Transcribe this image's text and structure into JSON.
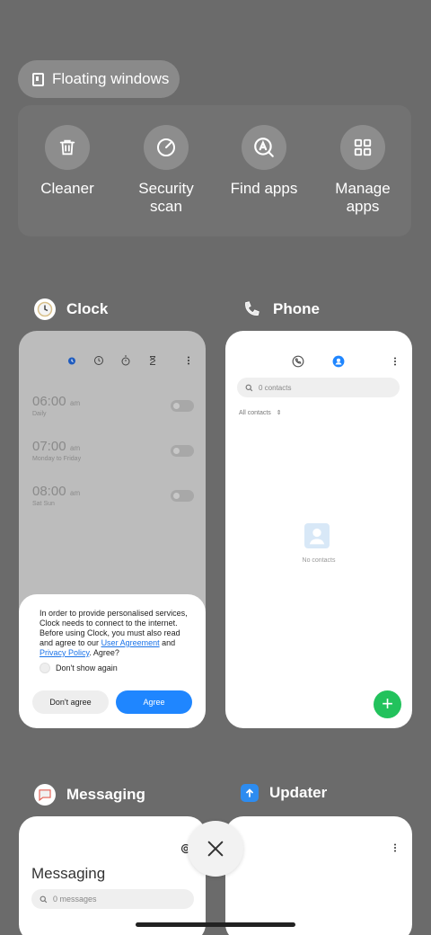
{
  "floating_windows": {
    "label": "Floating windows"
  },
  "tools": [
    {
      "label": "Cleaner",
      "icon": "trash-icon"
    },
    {
      "label": "Security\nscan",
      "icon": "security-scan-icon"
    },
    {
      "label": "Find apps",
      "icon": "find-apps-icon"
    },
    {
      "label": "Manage\napps",
      "icon": "manage-apps-icon"
    }
  ],
  "clock": {
    "title": "Clock",
    "alarms": [
      {
        "time": "06:00",
        "ampm": "am",
        "repeat": "Daily"
      },
      {
        "time": "07:00",
        "ampm": "am",
        "repeat": "Monday to Friday"
      },
      {
        "time": "08:00",
        "ampm": "am",
        "repeat": "Sat Sun"
      }
    ],
    "consent": {
      "text_before": "In order to provide personalised services, Clock needs to connect to the internet. Before using Clock, you must also read and agree to our ",
      "link1": "User Agreement",
      "and": " and ",
      "link2": "Privacy Policy",
      "text_after": ". Agree?",
      "dont_show": "Don't show again",
      "disagree": "Don't agree",
      "agree": "Agree"
    }
  },
  "phone": {
    "title": "Phone",
    "search_placeholder": "0 contacts",
    "filter": "All contacts",
    "empty": "No contacts",
    "accent": "#1f86ff"
  },
  "messaging": {
    "title": "Messaging",
    "header": "Messaging",
    "search_placeholder": "0 messages"
  },
  "updater": {
    "title": "Updater"
  }
}
